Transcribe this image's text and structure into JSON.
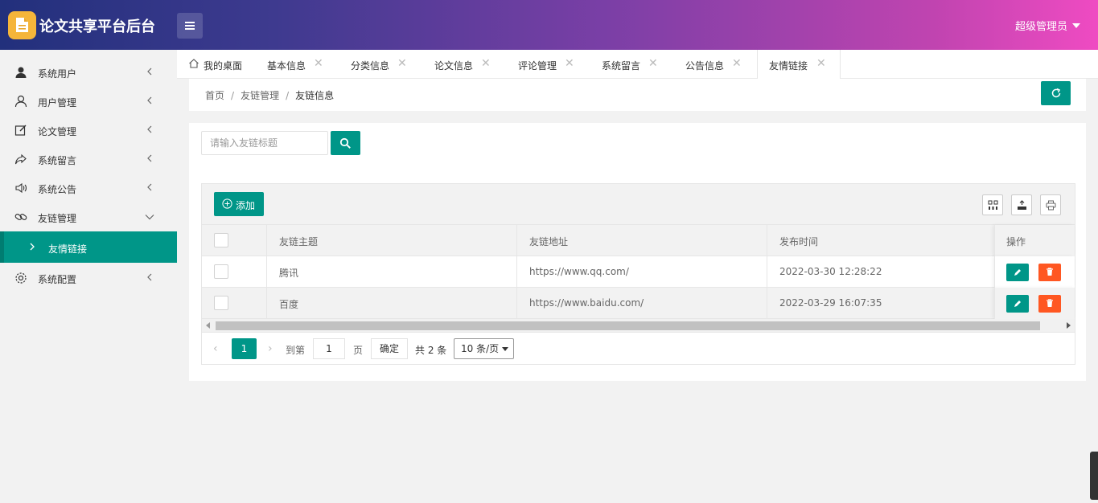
{
  "header": {
    "app_title": "论文共享平台后台",
    "user": "超级管理员"
  },
  "sidebar": {
    "items": [
      {
        "label": "系统用户",
        "icon": "user-solid-icon"
      },
      {
        "label": "用户管理",
        "icon": "user-outline-icon"
      },
      {
        "label": "论文管理",
        "icon": "edit-icon"
      },
      {
        "label": "系统留言",
        "icon": "share-icon"
      },
      {
        "label": "系统公告",
        "icon": "speaker-icon"
      },
      {
        "label": "友链管理",
        "icon": "link-icon"
      },
      {
        "label": "系统配置",
        "icon": "gear-icon"
      }
    ],
    "sub_item": "友情链接"
  },
  "tabs": [
    {
      "label": "我的桌面"
    },
    {
      "label": "基本信息"
    },
    {
      "label": "分类信息"
    },
    {
      "label": "论文信息"
    },
    {
      "label": "评论管理"
    },
    {
      "label": "系统留言"
    },
    {
      "label": "公告信息"
    },
    {
      "label": "友情链接"
    }
  ],
  "breadcrumb": [
    "首页",
    "友链管理",
    "友链信息"
  ],
  "search": {
    "placeholder": "请输入友链标题"
  },
  "toolbar": {
    "add_label": "添加"
  },
  "table": {
    "headers": [
      "友链主题",
      "友链地址",
      "发布时间",
      "操作"
    ],
    "rows": [
      {
        "title": "腾讯",
        "url": "https://www.qq.com/",
        "time": "2022-03-30 12:28:22"
      },
      {
        "title": "百度",
        "url": "https://www.baidu.com/",
        "time": "2022-03-29 16:07:35"
      }
    ]
  },
  "pager": {
    "current": "1",
    "goto_label": "到第",
    "goto_value": "1",
    "page_unit": "页",
    "confirm": "确定",
    "total": "共 2 条",
    "page_size": "10 条/页"
  },
  "colors": {
    "primary": "#009688",
    "danger": "#ff5722"
  }
}
